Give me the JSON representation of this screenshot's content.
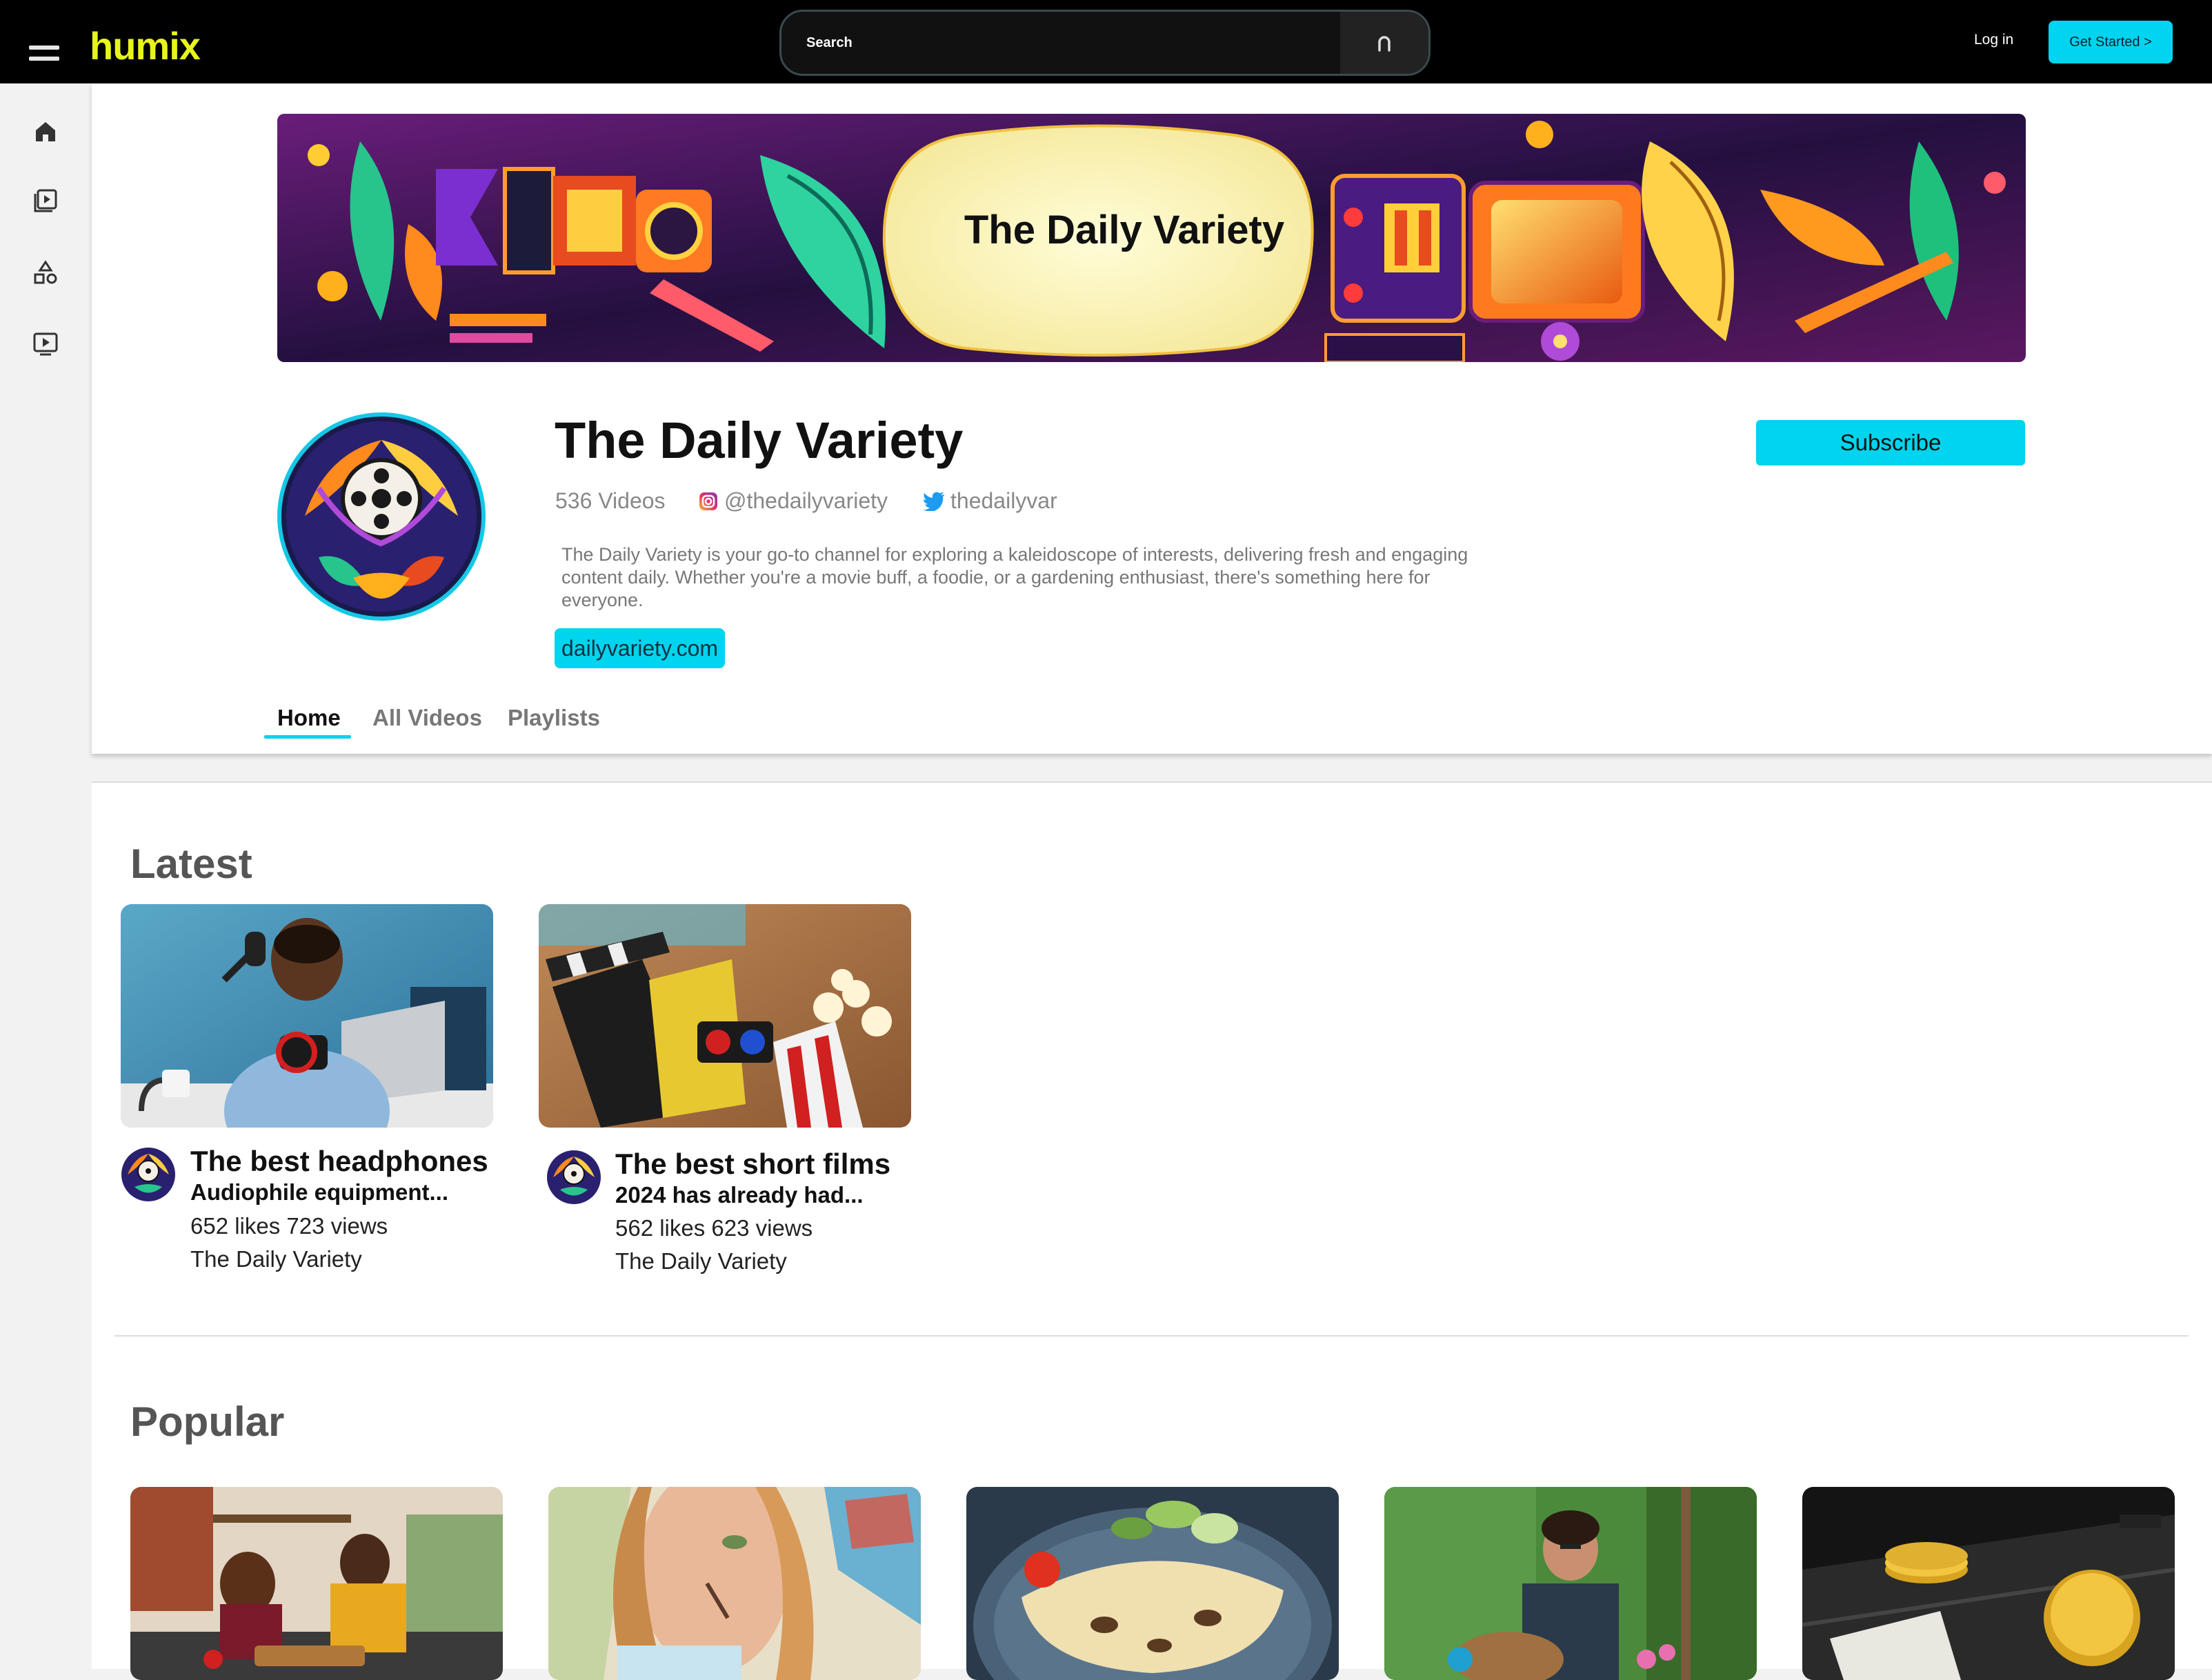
{
  "brand": {
    "logo_text": "humix",
    "accent": "#00d4ee",
    "logo_color": "#e6f51a"
  },
  "header": {
    "search_placeholder": "Search",
    "login_label": "Log in",
    "get_started_label": "Get Started >"
  },
  "sidebar": {
    "items": [
      {
        "icon": "home-icon"
      },
      {
        "icon": "video-library-icon"
      },
      {
        "icon": "categories-icon"
      },
      {
        "icon": "play-screen-icon"
      }
    ]
  },
  "channel": {
    "banner_text": "The Daily Variety",
    "name": "The Daily Variety",
    "video_count": "536 Videos",
    "instagram": "@thedailyvariety",
    "twitter": "thedailyvar",
    "description": "The Daily Variety is your go-to channel for exploring a kaleidoscope of interests, delivering fresh and engaging content daily. Whether you're a movie buff, a foodie, or a gardening enthusiast, there's something here for everyone.",
    "website": "dailyvariety.com",
    "subscribe_label": "Subscribe"
  },
  "tabs": [
    {
      "label": "Home",
      "active": true
    },
    {
      "label": "All Videos",
      "active": false
    },
    {
      "label": "Playlists",
      "active": false
    }
  ],
  "latest": {
    "title": "Latest",
    "videos": [
      {
        "title": "The best headphones",
        "subtitle": "Audiophile equipment...",
        "stats": "652 likes 723 views",
        "channel": "The Daily Variety"
      },
      {
        "title": "The best short films",
        "subtitle": "2024 has already had...",
        "stats": "562 likes 623 views",
        "channel": "The Daily Variety"
      }
    ]
  },
  "popular": {
    "title": "Popular"
  }
}
